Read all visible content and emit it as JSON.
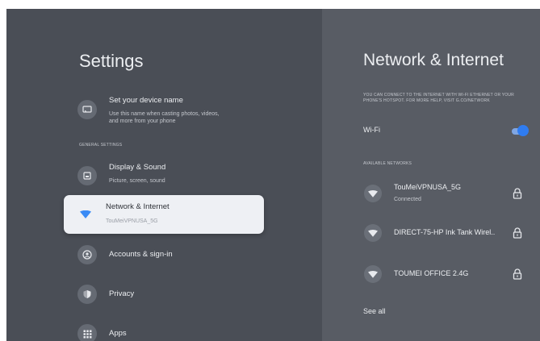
{
  "settings": {
    "title": "Settings",
    "device_name": {
      "title": "Set your device name",
      "subtitle_line1": "Use this name when casting photos, videos,",
      "subtitle_line2": "and more from your phone"
    },
    "general_label": "GENERAL SETTINGS",
    "items": [
      {
        "title": "Display & Sound",
        "subtitle": "Picture, screen, sound",
        "icon": "display-icon"
      },
      {
        "title": "Network & Internet",
        "subtitle": "TouMeiVPNUSA_5G",
        "icon": "wifi-icon"
      },
      {
        "title": "Accounts & sign-in",
        "icon": "account-icon"
      },
      {
        "title": "Privacy",
        "icon": "shield-icon"
      },
      {
        "title": "Apps",
        "icon": "apps-grid-icon"
      }
    ]
  },
  "network": {
    "title": "Network & Internet",
    "info_line1": "YOU CAN CONNECT TO THE INTERNET WITH WI-FI ETHERNET OR YOUR",
    "info_line2": "PHONE'S HOTSPOT. FOR MORE HELP, VISIT G.CO/NETWORK",
    "wifi_label": "Wi-Fi",
    "wifi_enabled": true,
    "available_label": "AVAILABLE NETWORKS",
    "networks": [
      {
        "name": "TouMeiVPNUSA_5G",
        "status": "Connected",
        "locked": true
      },
      {
        "name": "DIRECT-75-HP Ink Tank Wirel..",
        "locked": true
      },
      {
        "name": "TOUMEI OFFICE 2.4G",
        "locked": true
      }
    ],
    "see_all": "See all"
  },
  "colors": {
    "background": "#4a4e56",
    "panel": "#585c64",
    "selected_card": "#eef0f4",
    "accent": "#2f7cf0"
  }
}
